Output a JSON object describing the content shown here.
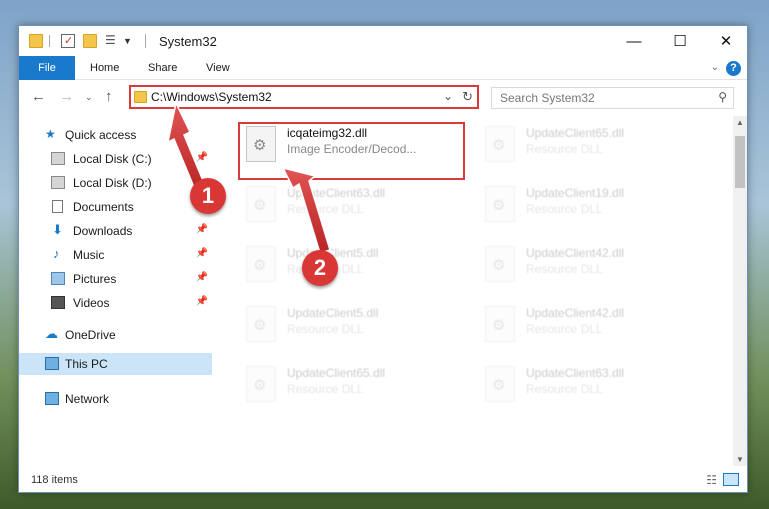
{
  "window": {
    "title": "System32"
  },
  "ribbon": {
    "tabs": [
      "File",
      "Home",
      "Share",
      "View"
    ],
    "help": "?"
  },
  "nav": {
    "path": "C:\\Windows\\System32",
    "search_placeholder": "Search System32"
  },
  "sidebar": {
    "items": [
      {
        "label": "Quick access",
        "icon": "star-icon"
      },
      {
        "label": "Local Disk (C:)",
        "icon": "drive-icon",
        "pinned": true
      },
      {
        "label": "Local Disk (D:)",
        "icon": "drive-icon"
      },
      {
        "label": "Documents",
        "icon": "document-icon"
      },
      {
        "label": "Downloads",
        "icon": "download-icon",
        "pinned": true
      },
      {
        "label": "Music",
        "icon": "music-icon",
        "pinned": true
      },
      {
        "label": "Pictures",
        "icon": "pictures-icon",
        "pinned": true
      },
      {
        "label": "Videos",
        "icon": "video-icon",
        "pinned": true
      },
      {
        "label": "OneDrive",
        "icon": "cloud-icon"
      },
      {
        "label": "This PC",
        "icon": "computer-icon"
      },
      {
        "label": "Network",
        "icon": "network-icon"
      }
    ]
  },
  "files": [
    {
      "name": "icqateimg32.dll",
      "type": "Image Encoder/Decod..."
    },
    {
      "name": "UpdateClient65.dll",
      "type": "Resource DLL"
    },
    {
      "name": "UpdateClient63.dll",
      "type": "Resource DLL"
    },
    {
      "name": "UpdateClient19.dll",
      "type": "Resource DLL"
    },
    {
      "name": "UpdateClient5.dll",
      "type": "Resource DLL"
    },
    {
      "name": "UpdateClient42.dll",
      "type": "Resource DLL"
    },
    {
      "name": "UpdateClient5.dll",
      "type": "Resource DLL"
    },
    {
      "name": "UpdateClient42.dll",
      "type": "Resource DLL"
    },
    {
      "name": "UpdateClient65.dll",
      "type": "Resource DLL"
    },
    {
      "name": "UpdateClient63.dll",
      "type": "Resource DLL"
    }
  ],
  "status": {
    "items": "118 items"
  },
  "markers": [
    "1",
    "2"
  ],
  "colors": {
    "accent": "#1979ca",
    "highlight": "#d83b3b",
    "selected": "#cce4f7"
  }
}
